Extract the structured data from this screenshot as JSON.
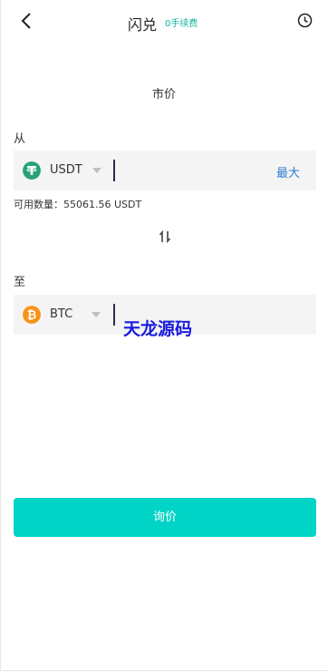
{
  "header": {
    "title": "闪兑",
    "fee_badge": "0手续费"
  },
  "order_type": "市价",
  "from": {
    "label": "从",
    "coin": "USDT",
    "coin_icon": "tether-icon",
    "coin_color": "#26a17b",
    "max_label": "最大",
    "available_text": "可用数量：55061.56 USDT"
  },
  "to": {
    "label": "至",
    "coin": "BTC",
    "coin_icon": "bitcoin-icon",
    "coin_color": "#f7931a"
  },
  "watermark": "天龙源码",
  "quote_button": "询价",
  "colors": {
    "accent": "#00d4c6",
    "fee_text": "#16b39a",
    "link": "#2f7fd1"
  }
}
